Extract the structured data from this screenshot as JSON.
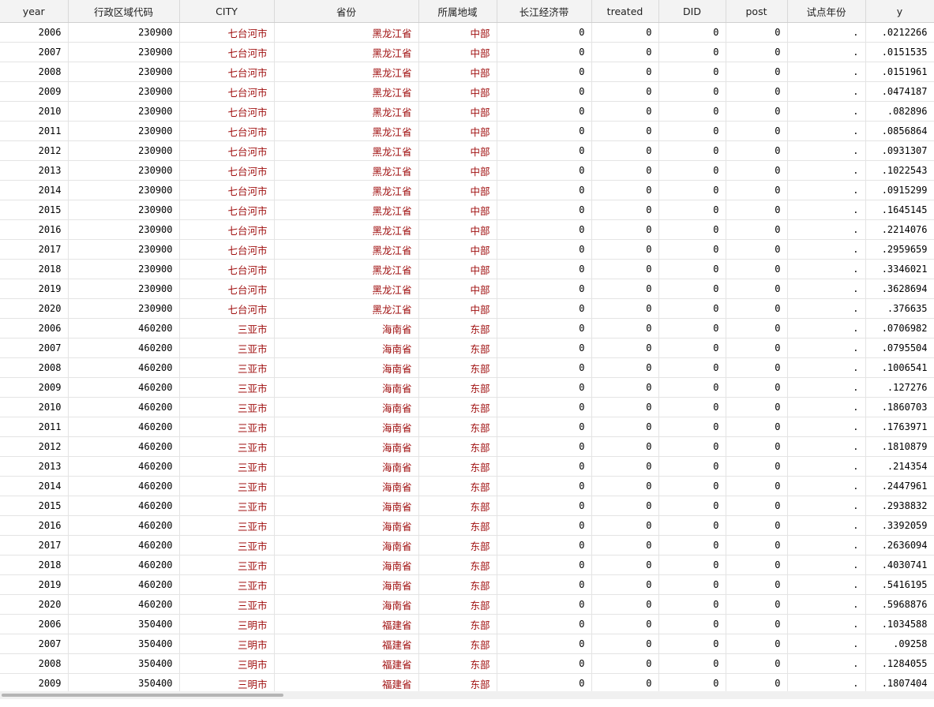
{
  "columns": [
    "year",
    "行政区域代码",
    "CITY",
    "省份",
    "所属地域",
    "长江经济带",
    "treated",
    "DID",
    "post",
    "试点年份",
    "y"
  ],
  "rows": [
    [
      "2006",
      "230900",
      "七台河市",
      "黑龙江省",
      "中部",
      "0",
      "0",
      "0",
      "0",
      ".",
      ".0212266"
    ],
    [
      "2007",
      "230900",
      "七台河市",
      "黑龙江省",
      "中部",
      "0",
      "0",
      "0",
      "0",
      ".",
      ".0151535"
    ],
    [
      "2008",
      "230900",
      "七台河市",
      "黑龙江省",
      "中部",
      "0",
      "0",
      "0",
      "0",
      ".",
      ".0151961"
    ],
    [
      "2009",
      "230900",
      "七台河市",
      "黑龙江省",
      "中部",
      "0",
      "0",
      "0",
      "0",
      ".",
      ".0474187"
    ],
    [
      "2010",
      "230900",
      "七台河市",
      "黑龙江省",
      "中部",
      "0",
      "0",
      "0",
      "0",
      ".",
      ".082896"
    ],
    [
      "2011",
      "230900",
      "七台河市",
      "黑龙江省",
      "中部",
      "0",
      "0",
      "0",
      "0",
      ".",
      ".0856864"
    ],
    [
      "2012",
      "230900",
      "七台河市",
      "黑龙江省",
      "中部",
      "0",
      "0",
      "0",
      "0",
      ".",
      ".0931307"
    ],
    [
      "2013",
      "230900",
      "七台河市",
      "黑龙江省",
      "中部",
      "0",
      "0",
      "0",
      "0",
      ".",
      ".1022543"
    ],
    [
      "2014",
      "230900",
      "七台河市",
      "黑龙江省",
      "中部",
      "0",
      "0",
      "0",
      "0",
      ".",
      ".0915299"
    ],
    [
      "2015",
      "230900",
      "七台河市",
      "黑龙江省",
      "中部",
      "0",
      "0",
      "0",
      "0",
      ".",
      ".1645145"
    ],
    [
      "2016",
      "230900",
      "七台河市",
      "黑龙江省",
      "中部",
      "0",
      "0",
      "0",
      "0",
      ".",
      ".2214076"
    ],
    [
      "2017",
      "230900",
      "七台河市",
      "黑龙江省",
      "中部",
      "0",
      "0",
      "0",
      "0",
      ".",
      ".2959659"
    ],
    [
      "2018",
      "230900",
      "七台河市",
      "黑龙江省",
      "中部",
      "0",
      "0",
      "0",
      "0",
      ".",
      ".3346021"
    ],
    [
      "2019",
      "230900",
      "七台河市",
      "黑龙江省",
      "中部",
      "0",
      "0",
      "0",
      "0",
      ".",
      ".3628694"
    ],
    [
      "2020",
      "230900",
      "七台河市",
      "黑龙江省",
      "中部",
      "0",
      "0",
      "0",
      "0",
      ".",
      ".376635"
    ],
    [
      "2006",
      "460200",
      "三亚市",
      "海南省",
      "东部",
      "0",
      "0",
      "0",
      "0",
      ".",
      ".0706982"
    ],
    [
      "2007",
      "460200",
      "三亚市",
      "海南省",
      "东部",
      "0",
      "0",
      "0",
      "0",
      ".",
      ".0795504"
    ],
    [
      "2008",
      "460200",
      "三亚市",
      "海南省",
      "东部",
      "0",
      "0",
      "0",
      "0",
      ".",
      ".1006541"
    ],
    [
      "2009",
      "460200",
      "三亚市",
      "海南省",
      "东部",
      "0",
      "0",
      "0",
      "0",
      ".",
      ".127276"
    ],
    [
      "2010",
      "460200",
      "三亚市",
      "海南省",
      "东部",
      "0",
      "0",
      "0",
      "0",
      ".",
      ".1860703"
    ],
    [
      "2011",
      "460200",
      "三亚市",
      "海南省",
      "东部",
      "0",
      "0",
      "0",
      "0",
      ".",
      ".1763971"
    ],
    [
      "2012",
      "460200",
      "三亚市",
      "海南省",
      "东部",
      "0",
      "0",
      "0",
      "0",
      ".",
      ".1810879"
    ],
    [
      "2013",
      "460200",
      "三亚市",
      "海南省",
      "东部",
      "0",
      "0",
      "0",
      "0",
      ".",
      ".214354"
    ],
    [
      "2014",
      "460200",
      "三亚市",
      "海南省",
      "东部",
      "0",
      "0",
      "0",
      "0",
      ".",
      ".2447961"
    ],
    [
      "2015",
      "460200",
      "三亚市",
      "海南省",
      "东部",
      "0",
      "0",
      "0",
      "0",
      ".",
      ".2938832"
    ],
    [
      "2016",
      "460200",
      "三亚市",
      "海南省",
      "东部",
      "0",
      "0",
      "0",
      "0",
      ".",
      ".3392059"
    ],
    [
      "2017",
      "460200",
      "三亚市",
      "海南省",
      "东部",
      "0",
      "0",
      "0",
      "0",
      ".",
      ".2636094"
    ],
    [
      "2018",
      "460200",
      "三亚市",
      "海南省",
      "东部",
      "0",
      "0",
      "0",
      "0",
      ".",
      ".4030741"
    ],
    [
      "2019",
      "460200",
      "三亚市",
      "海南省",
      "东部",
      "0",
      "0",
      "0",
      "0",
      ".",
      ".5416195"
    ],
    [
      "2020",
      "460200",
      "三亚市",
      "海南省",
      "东部",
      "0",
      "0",
      "0",
      "0",
      ".",
      ".5968876"
    ],
    [
      "2006",
      "350400",
      "三明市",
      "福建省",
      "东部",
      "0",
      "0",
      "0",
      "0",
      ".",
      ".1034588"
    ],
    [
      "2007",
      "350400",
      "三明市",
      "福建省",
      "东部",
      "0",
      "0",
      "0",
      "0",
      ".",
      ".09258"
    ],
    [
      "2008",
      "350400",
      "三明市",
      "福建省",
      "东部",
      "0",
      "0",
      "0",
      "0",
      ".",
      ".1284055"
    ],
    [
      "2009",
      "350400",
      "三明市",
      "福建省",
      "东部",
      "0",
      "0",
      "0",
      "0",
      ".",
      ".1807404"
    ]
  ],
  "string_columns": [
    2,
    3,
    4
  ],
  "colors": {
    "string_text": "#a01010",
    "header_bg": "#f3f3f3",
    "grid_line": "#e4e4e4"
  }
}
